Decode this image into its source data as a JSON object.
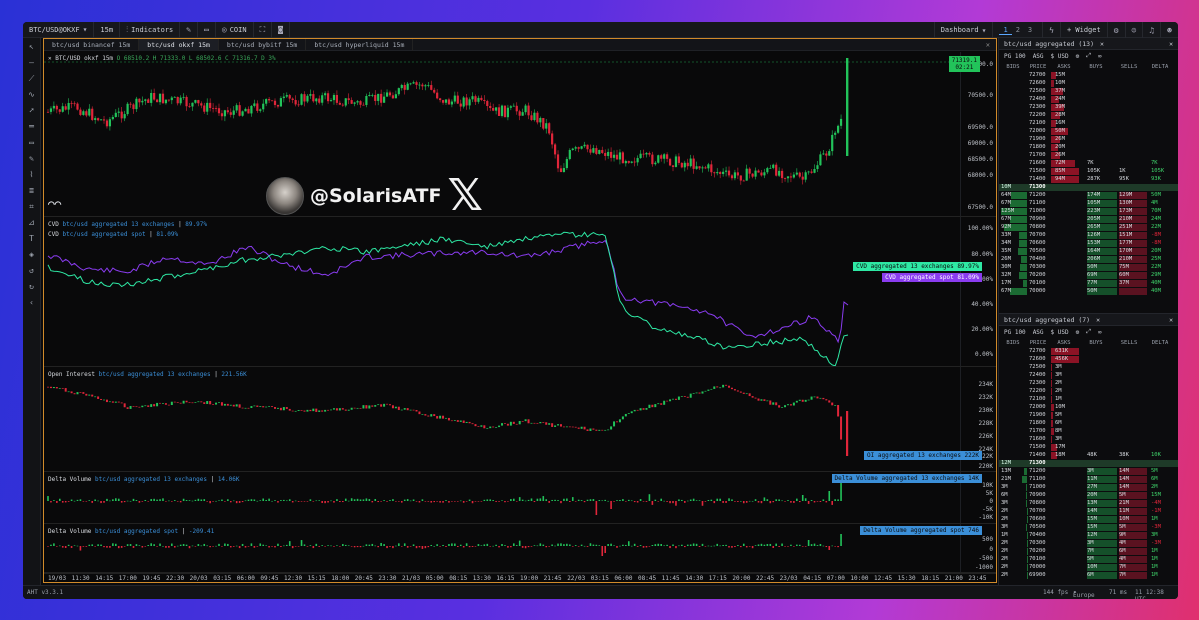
{
  "toolbar": {
    "symbol": "BTC/USD@OKXF",
    "timeframe": "15m",
    "indicators": "Indicators",
    "coin": "COIN",
    "dashboard": "Dashboard",
    "workspaces": [
      "1",
      "2",
      "3"
    ],
    "widget": "+ Widget"
  },
  "tabs": [
    "btc/usd binancef 15m",
    "btc/usd okxf 15m",
    "btc/usd bybitf 15m",
    "btc/usd hyperliquid 15m"
  ],
  "price_pane": {
    "title": "BTC/USD okxf 15m",
    "ohlc": "O 68510.2 H 71333.0 L 68502.6 C 71316.7 D 3%",
    "last_price": "71319.1",
    "countdown": "02:21",
    "scale": [
      "71500.0",
      "70500.0",
      "69500.0",
      "69000.0",
      "68500.0",
      "68000.0",
      "67500.0"
    ],
    "watermark": "@SolarisATF"
  },
  "cvd_pane": {
    "legend1_name": "CVD",
    "legend1_sub": "btc/usd aggregated 13 exchanges",
    "legend1_val": "89.97%",
    "legend2_name": "CVD",
    "legend2_sub": "btc/usd aggregated spot",
    "legend2_val": "81.09%",
    "scale": [
      "100.00%",
      "80.00%",
      "60.00%",
      "40.00%",
      "20.00%",
      "0.00%"
    ],
    "tag1": "CVD aggregated 13 exchanges 89.97%",
    "tag2": "CVD aggregated spot 81.09%"
  },
  "oi_pane": {
    "name": "Open Interest",
    "sub": "btc/usd aggregated 13 exchanges",
    "val": "221.56K",
    "scale": [
      "234K",
      "232K",
      "230K",
      "228K",
      "226K",
      "224K",
      "222K",
      "220K"
    ],
    "tag": "OI aggregated 13 exchanges 222K"
  },
  "dv1_pane": {
    "name": "Delta Volume",
    "sub": "btc/usd aggregated 13 exchanges",
    "val": "14.06K",
    "scale": [
      "10K",
      "5K",
      "0",
      "-5K",
      "-10K"
    ],
    "tag": "Delta Volume aggregated 13 exchanges 14K"
  },
  "dv2_pane": {
    "name": "Delta Volume",
    "sub": "btc/usd aggregated spot",
    "val": "-209.41",
    "scale": [
      "500",
      "0",
      "-500",
      "-1000"
    ],
    "tag": "Delta Volume aggregated spot 746"
  },
  "time_axis": [
    "19/03",
    "11:30",
    "14:15",
    "17:00",
    "19:45",
    "22:30",
    "20/03",
    "03:15",
    "06:00",
    "09:45",
    "12:30",
    "15:15",
    "18:00",
    "20:45",
    "23:30",
    "21/03",
    "05:00",
    "08:15",
    "13:30",
    "16:15",
    "19:00",
    "21:45",
    "22/03",
    "03:15",
    "06:00",
    "08:45",
    "11:45",
    "14:30",
    "17:15",
    "20:00",
    "22:45",
    "23/03",
    "04:15",
    "07:00",
    "10:00",
    "12:45",
    "15:30",
    "18:15",
    "21:00",
    "23:45"
  ],
  "status": {
    "version": "AHT v3.3.1",
    "fps": "144 fps",
    "region": "Europe",
    "latency": "71 ms",
    "clock": "11 12:38 UTC"
  },
  "dom1": {
    "title": "btc/usd aggregated (13)",
    "pg": "PG 100",
    "asg": "ASG",
    "ccy": "$ USD",
    "cols": [
      "BIDS",
      "PRICE",
      "ASKS",
      "BUYS",
      "SELLS",
      "DELTA"
    ],
    "mid": "71300",
    "mid_bid": "10M",
    "asks": [
      [
        "",
        "72700",
        "15M",
        "",
        "",
        ""
      ],
      [
        "",
        "72600",
        "10M",
        "",
        "",
        ""
      ],
      [
        "",
        "72500",
        "37M",
        "",
        "",
        ""
      ],
      [
        "",
        "72400",
        "24M",
        "",
        "",
        ""
      ],
      [
        "",
        "72300",
        "39M",
        "",
        "",
        ""
      ],
      [
        "",
        "72200",
        "28M",
        "",
        "",
        ""
      ],
      [
        "",
        "72100",
        "16M",
        "",
        "",
        ""
      ],
      [
        "",
        "72000",
        "50M",
        "",
        "",
        ""
      ],
      [
        "",
        "71900",
        "26M",
        "",
        "",
        ""
      ],
      [
        "",
        "71800",
        "20M",
        "",
        "",
        ""
      ],
      [
        "",
        "71700",
        "26M",
        "",
        "",
        ""
      ],
      [
        "",
        "71600",
        "72M",
        "7K",
        "",
        "7K"
      ],
      [
        "",
        "71500",
        "85M",
        "105K",
        "1K",
        "105K"
      ],
      [
        "",
        "71400",
        "94M",
        "287K",
        "95K",
        "93K"
      ]
    ],
    "bids": [
      [
        "64M",
        "71200",
        "",
        "174M",
        "129M",
        "50M"
      ],
      [
        "67M",
        "71100",
        "",
        "105M",
        "130M",
        "4M"
      ],
      [
        "125M",
        "71000",
        "",
        "223M",
        "173M",
        "70M"
      ],
      [
        "67M",
        "70900",
        "",
        "205M",
        "210M",
        "24M"
      ],
      [
        "92M",
        "70800",
        "",
        "265M",
        "251M",
        "22M"
      ],
      [
        "33M",
        "70700",
        "",
        "126M",
        "151M",
        "-8M"
      ],
      [
        "34M",
        "70600",
        "",
        "153M",
        "177M",
        "-8M"
      ],
      [
        "35M",
        "70500",
        "",
        "164M",
        "170M",
        "20M"
      ],
      [
        "26M",
        "70400",
        "",
        "206M",
        "210M",
        "25M"
      ],
      [
        "30M",
        "70300",
        "",
        "50M",
        "75M",
        "22M"
      ],
      [
        "32M",
        "70200",
        "",
        "69M",
        "60M",
        "29M"
      ],
      [
        "17M",
        "70100",
        "",
        "77M",
        "37M",
        "40M"
      ],
      [
        "67M",
        "70000",
        "",
        "50M",
        "",
        "40M"
      ]
    ]
  },
  "dom2": {
    "title": "btc/usd aggregated (7)",
    "pg": "PG 100",
    "asg": "ASG",
    "ccy": "$ USD",
    "cols": [
      "BIDS",
      "PRICE",
      "ASKS",
      "BUYS",
      "SELLS",
      "DELTA"
    ],
    "mid": "71300",
    "mid_bid": "12M",
    "asks": [
      [
        "",
        "72700",
        "631K",
        "",
        "",
        ""
      ],
      [
        "",
        "72600",
        "456K",
        "",
        "",
        ""
      ],
      [
        "",
        "72500",
        "3M",
        "",
        "",
        ""
      ],
      [
        "",
        "72400",
        "3M",
        "",
        "",
        ""
      ],
      [
        "",
        "72300",
        "2M",
        "",
        "",
        ""
      ],
      [
        "",
        "72200",
        "2M",
        "",
        "",
        ""
      ],
      [
        "",
        "72100",
        "1M",
        "",
        "",
        ""
      ],
      [
        "",
        "72000",
        "10M",
        "",
        "",
        ""
      ],
      [
        "",
        "71900",
        "5M",
        "",
        "",
        ""
      ],
      [
        "",
        "71800",
        "6M",
        "",
        "",
        ""
      ],
      [
        "",
        "71700",
        "8M",
        "",
        "",
        ""
      ],
      [
        "",
        "71600",
        "3M",
        "",
        "",
        ""
      ],
      [
        "",
        "71500",
        "17M",
        "",
        "",
        ""
      ],
      [
        "",
        "71400",
        "18M",
        "48K",
        "38K",
        "10K"
      ]
    ],
    "bids": [
      [
        "13M",
        "71200",
        "",
        "3M",
        "14M",
        "5M"
      ],
      [
        "21M",
        "71100",
        "",
        "11M",
        "14M",
        "6M"
      ],
      [
        "3M",
        "71000",
        "",
        "27M",
        "14M",
        "2M"
      ],
      [
        "6M",
        "70900",
        "",
        "20M",
        "5M",
        "15M"
      ],
      [
        "3M",
        "70800",
        "",
        "13M",
        "21M",
        "-4M"
      ],
      [
        "2M",
        "70700",
        "",
        "14M",
        "11M",
        "-1M"
      ],
      [
        "2M",
        "70600",
        "",
        "15M",
        "10M",
        "1M"
      ],
      [
        "3M",
        "70500",
        "",
        "15M",
        "5M",
        "-3M"
      ],
      [
        "1M",
        "70400",
        "",
        "12M",
        "9M",
        "3M"
      ],
      [
        "2M",
        "70300",
        "",
        "3M",
        "4M",
        "-3M"
      ],
      [
        "2M",
        "70200",
        "",
        "7M",
        "6M",
        "1M"
      ],
      [
        "2M",
        "70100",
        "",
        "5M",
        "4M",
        "1M"
      ],
      [
        "2M",
        "70000",
        "",
        "10M",
        "7M",
        "1M"
      ],
      [
        "2M",
        "69900",
        "",
        "6M",
        "7M",
        "1M"
      ]
    ]
  },
  "colors": {
    "up": "#22c35a",
    "down": "#e0263a",
    "accent": "#d08a2a",
    "cvd_agg": "#2ee8a4",
    "cvd_spot": "#8a3cf0",
    "blue": "#3b8fd8"
  }
}
